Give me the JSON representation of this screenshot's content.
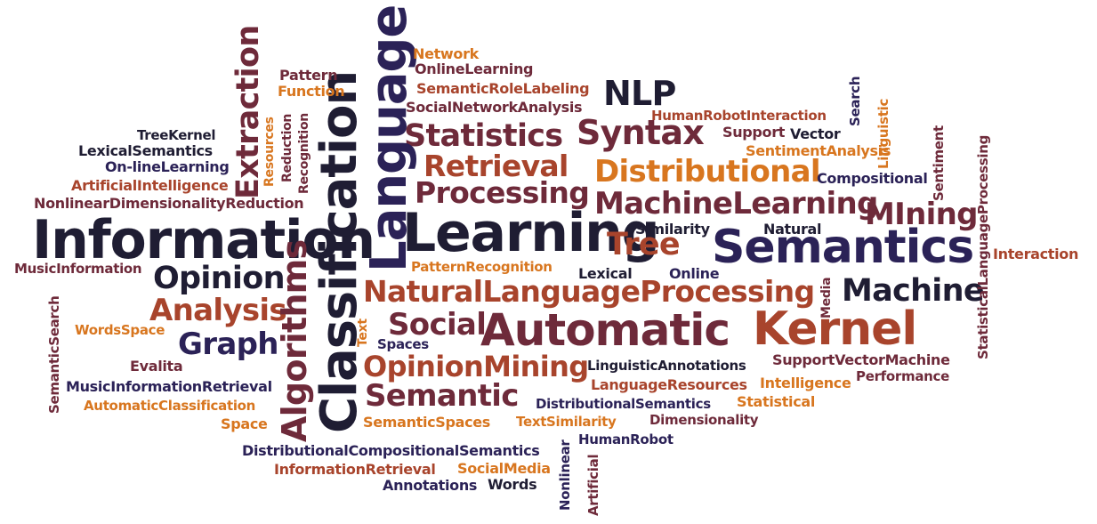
{
  "palette": {
    "navy": "#2b2257",
    "maroon": "#6e2a3a",
    "rust": "#a8442c",
    "orange": "#d8761f",
    "dark": "#1f1d33"
  },
  "words": [
    "Information",
    "Learning",
    "Semantics",
    "Automatic",
    "Kernel",
    "Classification",
    "Language",
    "NaturalLanguageProcessing",
    "Algorithms",
    "MachineLearning",
    "Distributional",
    "Statistics",
    "Syntax",
    "Retrieval",
    "Processing",
    "Extraction",
    "Opinion",
    "Analysis",
    "Graph",
    "Social",
    "OpinionMining",
    "Semantic",
    "Machine",
    "NLP",
    "MIning",
    "Tree",
    "Network",
    "OnlineLearning",
    "SemanticRoleLabeling",
    "SocialNetworkAnalysis",
    "HumanRobotInteraction",
    "Support",
    "Vector",
    "SentimentAnalysis",
    "Compositional",
    "Pattern",
    "Function",
    "TreeKernel",
    "LexicalSemantics",
    "On-lineLearning",
    "ArtificialIntelligence",
    "NonlinearDimensionalityReduction",
    "MusicInformation",
    "WordsSpace",
    "Evalita",
    "MusicInformationRetrieval",
    "AutomaticClassification",
    "Space",
    "PatternRecognition",
    "Similarity",
    "Natural",
    "Lexical",
    "Online",
    "Interaction",
    "Spaces",
    "LinguisticAnnotations",
    "SupportVectorMachine",
    "LanguageResources",
    "Intelligence",
    "Performance",
    "DistributionalSemantics",
    "Statistical",
    "SemanticSpaces",
    "TextSimilarity",
    "Dimensionality",
    "HumanRobot",
    "DistributionalCompositionalSemantics",
    "InformationRetrieval",
    "SocialMedia",
    "Annotations",
    "Words",
    "Resources",
    "Reduction",
    "Recognition",
    "SemanticSearch",
    "Text",
    "Media",
    "Search",
    "Linguistic",
    "Sentiment",
    "StatisticalLanguageProcessing",
    "Nonlinear",
    "Artificial"
  ]
}
